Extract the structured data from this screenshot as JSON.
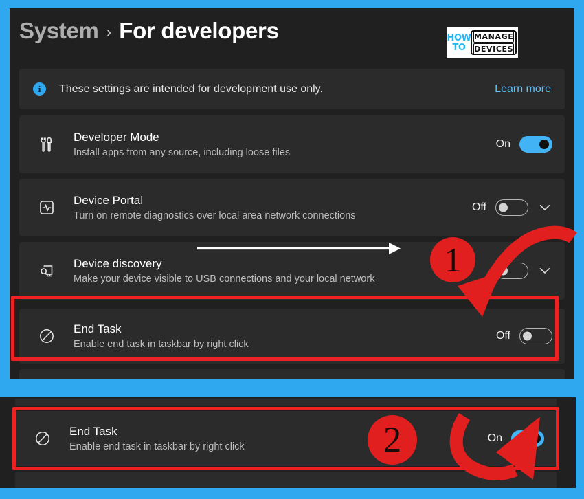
{
  "window": {
    "background_color": "#2fa8f0",
    "panel_color": "#202020",
    "card_color": "#2b2b2b",
    "accent_color": "#2fa8f0",
    "annotation_color": "#e21f1f"
  },
  "header": {
    "breadcrumb_parent": "System",
    "breadcrumb_separator": "›",
    "breadcrumb_current": "For developers",
    "logo": {
      "line1": "HOW",
      "line2": "TO",
      "word1": "MANAGE",
      "word2": "DEVICES"
    }
  },
  "banner": {
    "icon": "info-icon",
    "glyph": "i",
    "text": "These settings are intended for development use only.",
    "link_label": "Learn more"
  },
  "settings": [
    {
      "key": "developer_mode",
      "icon": "wrench-screwdriver-icon",
      "title": "Developer Mode",
      "subtitle": "Install apps from any source, including loose files",
      "toggle_label": "On",
      "toggle_state": "on",
      "has_expander": false
    },
    {
      "key": "device_portal",
      "icon": "device-portal-pulse-icon",
      "title": "Device Portal",
      "subtitle": "Turn on remote diagnostics over local area network connections",
      "toggle_label": "Off",
      "toggle_state": "off",
      "has_expander": true
    },
    {
      "key": "device_discovery",
      "icon": "device-discovery-icon",
      "title": "Device discovery",
      "subtitle": "Make your device visible to USB connections and your local network",
      "toggle_label": "",
      "toggle_state": "off",
      "has_expander": true
    },
    {
      "key": "end_task",
      "icon": "prohibition-icon",
      "title": "End Task",
      "subtitle": "Enable end task in taskbar by right click",
      "toggle_label": "Off",
      "toggle_state": "off",
      "has_expander": false
    }
  ],
  "bottom_panel": {
    "key": "end_task_enabled",
    "icon": "prohibition-icon",
    "title": "End Task",
    "subtitle": "Enable end task in taskbar by right click",
    "toggle_label": "On",
    "toggle_state": "on"
  },
  "annotations": {
    "step_one": "1",
    "step_two": "2",
    "white_arrow": "pointer-arrow-right",
    "red_arrow_one": "curved-arrow-down-left",
    "red_arrow_two": "curved-arrow-up-right"
  }
}
